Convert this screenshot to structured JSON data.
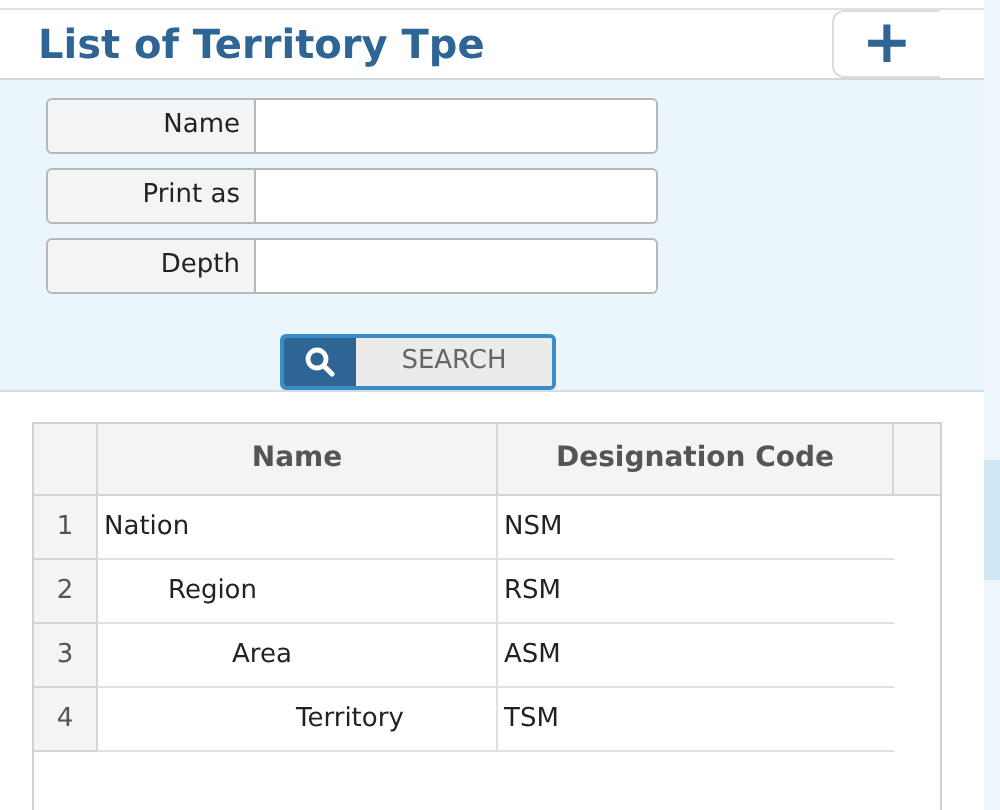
{
  "header": {
    "title": "List of Territory Tpe",
    "add_button": "+"
  },
  "search_form": {
    "fields": [
      {
        "label": "Name"
      },
      {
        "label": "Print as"
      },
      {
        "label": "Depth"
      }
    ],
    "search_button": "SEARCH"
  },
  "table": {
    "columns": [
      "Name",
      "Designation Code"
    ],
    "rows": [
      {
        "number": "1",
        "name": "Nation",
        "code": "NSM",
        "children": [
          {
            "number": "2",
            "name": "Region",
            "code": "RSM",
            "children": [
              {
                "number": "3",
                "name": "Area",
                "code": "ASM",
                "children": [
                  {
                    "number": "4",
                    "name": "Territory",
                    "code": "TSM"
                  }
                ]
              }
            ]
          }
        ]
      }
    ]
  }
}
